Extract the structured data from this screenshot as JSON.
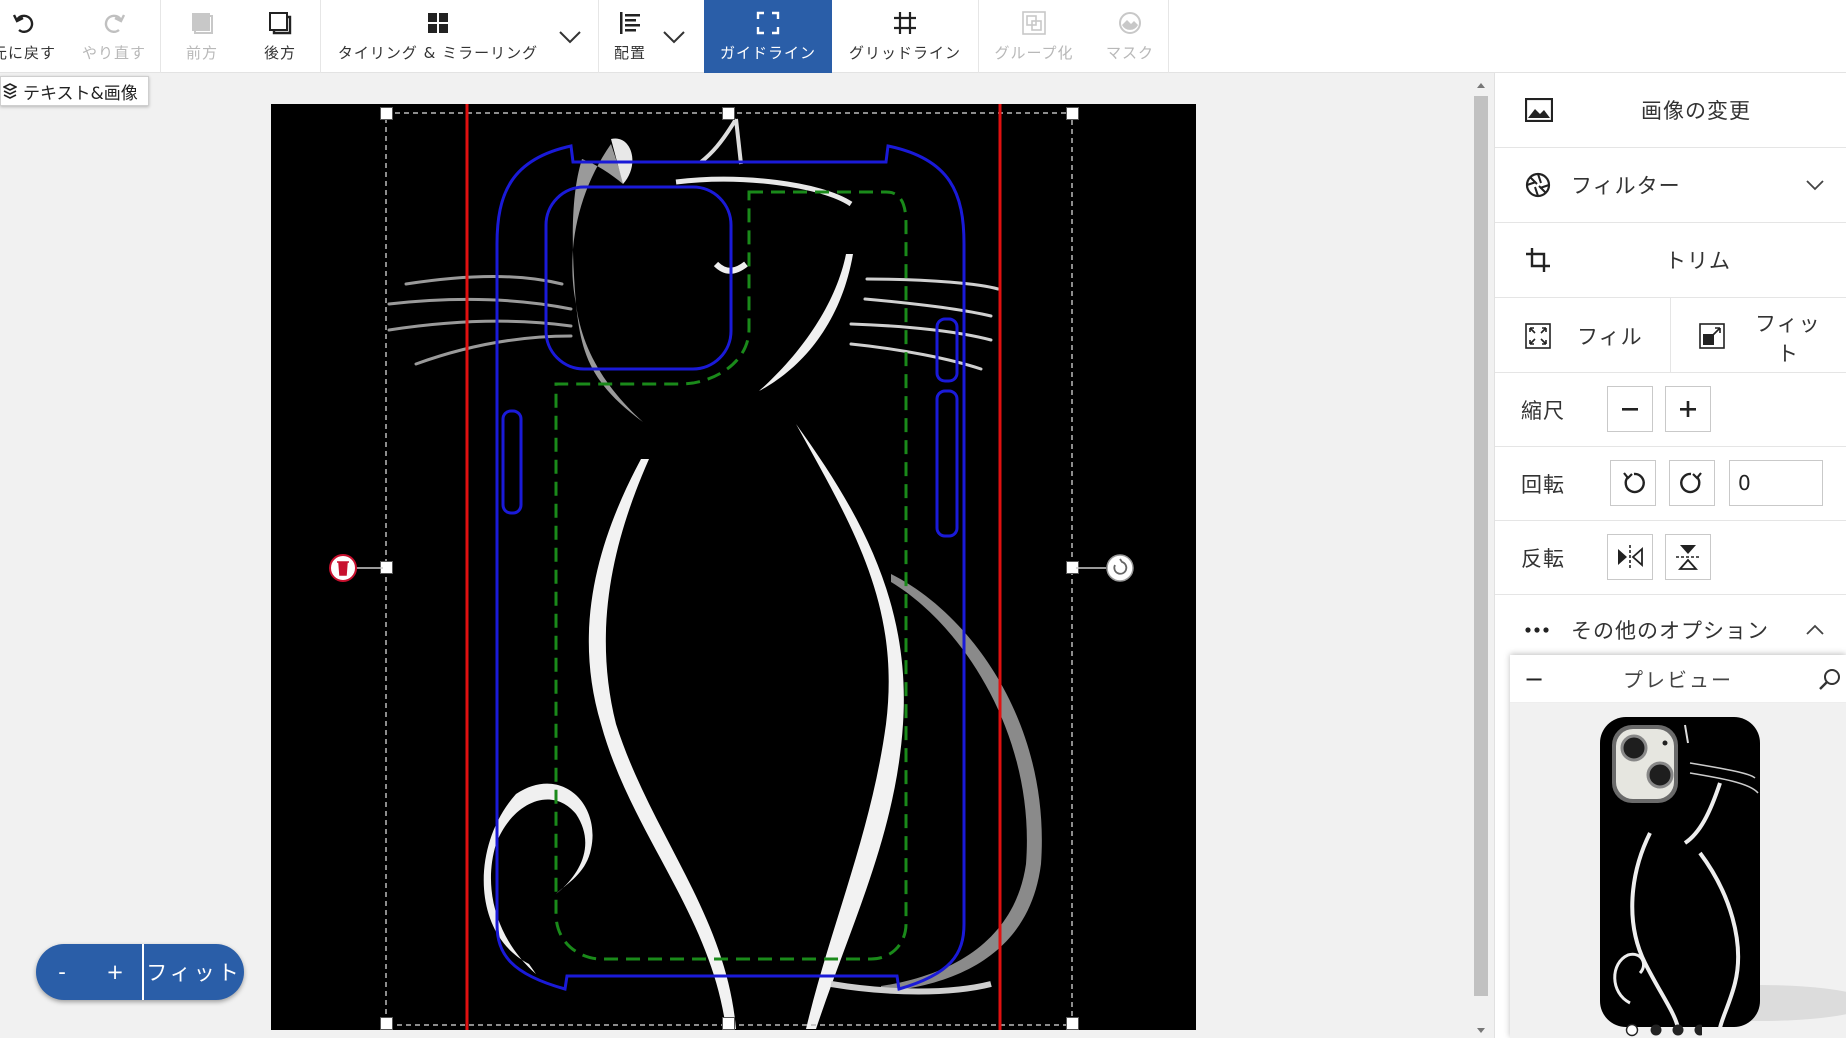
{
  "toolbar": {
    "undo": "元に戻す",
    "redo": "やり直す",
    "forward": "前方",
    "backward": "後方",
    "tiling": "タイリング & ミラーリング",
    "align": "配置",
    "guideline": "ガイドライン",
    "gridline": "グリッドライン",
    "group": "グループ化",
    "mask": "マスク"
  },
  "layers_tip": "テキスト&画像",
  "zoom": {
    "minus": "-",
    "plus": "+",
    "fit": "フィット"
  },
  "panel": {
    "change_image": "画像の変更",
    "filter": "フィルター",
    "trim": "トリム",
    "fill": "フィル",
    "fit_line1": "フィッ",
    "fit_line2": "ト",
    "scale": "縮尺",
    "rotate": "回転",
    "rotate_value": "0",
    "flip": "反転",
    "more_options": "その他のオプション"
  },
  "preview": {
    "title": "プレビュー",
    "collapse": "−"
  },
  "colors": {
    "accent": "#2a5ea8",
    "guide_red": "#e01010",
    "guide_blue": "#1a1ad8",
    "guide_green": "#1a8a1a"
  }
}
